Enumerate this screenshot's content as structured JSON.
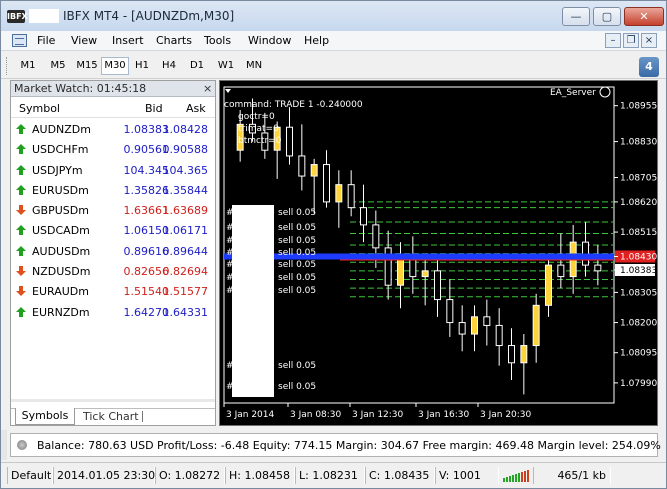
{
  "window": {
    "title": "IBFX MT4 - [AUDNZDm,M30]",
    "app_icon_text": "IBFX",
    "caption_buttons": {
      "minimize": "—",
      "maximize": "▢",
      "close": "✕"
    }
  },
  "menu": {
    "items": [
      "File",
      "View",
      "Insert",
      "Charts",
      "Tools",
      "Window",
      "Help"
    ],
    "mdi_buttons": {
      "minimize": "–",
      "restore": "❐",
      "close": "×"
    }
  },
  "timeframes": {
    "items": [
      "M1",
      "M5",
      "M15",
      "M30",
      "H1",
      "H4",
      "D1",
      "W1",
      "MN"
    ],
    "active": "M30",
    "notification_count": "4"
  },
  "market_watch": {
    "title": "Market Watch: 01:45:18",
    "close": "×",
    "columns": {
      "symbol": "Symbol",
      "bid": "Bid",
      "ask": "Ask"
    },
    "rows": [
      {
        "symbol": "AUDNZDm",
        "bid": "1.08383",
        "ask": "1.08428",
        "dir": "up"
      },
      {
        "symbol": "USDCHFm",
        "bid": "0.90561",
        "ask": "0.90588",
        "dir": "up"
      },
      {
        "symbol": "USDJPYm",
        "bid": "104.345",
        "ask": "104.365",
        "dir": "up"
      },
      {
        "symbol": "EURUSDm",
        "bid": "1.35826",
        "ask": "1.35844",
        "dir": "up"
      },
      {
        "symbol": "GBPUSDm",
        "bid": "1.63661",
        "ask": "1.63689",
        "dir": "down"
      },
      {
        "symbol": "USDCADm",
        "bid": "1.06150",
        "ask": "1.06171",
        "dir": "up"
      },
      {
        "symbol": "AUDUSDm",
        "bid": "0.89616",
        "ask": "0.89644",
        "dir": "up"
      },
      {
        "symbol": "NZDUSDm",
        "bid": "0.82656",
        "ask": "0.82694",
        "dir": "down"
      },
      {
        "symbol": "EURAUDm",
        "bid": "1.51540",
        "ask": "1.51577",
        "dir": "down"
      },
      {
        "symbol": "EURNZDm",
        "bid": "1.64270",
        "ask": "1.64331",
        "dir": "up"
      }
    ],
    "tabs": [
      "Symbols",
      "Tick Chart"
    ]
  },
  "chart": {
    "ea_name": "EA_Server",
    "ea_icon": "smiley-icon",
    "comment_lines": [
      "command: TRADE 1 -0.240000",
      "goctr=0",
      "trimat=0",
      "btmctr=0"
    ],
    "order_labels": [
      "sell 0.05",
      "sell 0.05",
      "sell 0.05",
      "sell 0.05",
      "sell 0.05",
      "sell 0.05",
      "sell 0.05",
      "sell 0.05",
      "sell 0.05"
    ],
    "price_ticks": [
      "1.08955",
      "1.08830",
      "1.08705",
      "1.08620",
      "1.08515",
      "1.08430",
      "1.08383",
      "1.08305",
      "1.08200",
      "1.08095",
      "1.07990"
    ],
    "time_ticks": [
      "3 Jan 2014",
      "3 Jan 08:30",
      "3 Jan 12:30",
      "3 Jan 16:30",
      "3 Jan 20:30"
    ],
    "colors": {
      "background": "#000000",
      "bull": "#ffd43a",
      "bear": "#000000",
      "wick": "#ffffff",
      "order_line": "#3cc83c",
      "ask_line": "#1e3cff",
      "bid_line": "#ff2020"
    }
  },
  "chart_data": {
    "type": "candlestick",
    "symbol": "AUDNZDm",
    "timeframe": "M30",
    "ylim": [
      1.0792,
      1.0902
    ],
    "yticks": [
      1.08955,
      1.0883,
      1.08705,
      1.0862,
      1.08515,
      1.0843,
      1.08383,
      1.08305,
      1.082,
      1.08095,
      1.0799
    ],
    "bid": 1.08383,
    "ask": 1.0843,
    "candles": [
      [
        1.088,
        1.0894,
        1.0876,
        1.0889
      ],
      [
        1.0889,
        1.0898,
        1.0883,
        1.0886
      ],
      [
        1.0886,
        1.0893,
        1.0877,
        1.088
      ],
      [
        1.088,
        1.089,
        1.087,
        1.0888
      ],
      [
        1.0888,
        1.0895,
        1.0875,
        1.0878
      ],
      [
        1.0878,
        1.0889,
        1.0866,
        1.0871
      ],
      [
        1.0871,
        1.0877,
        1.0858,
        1.0875
      ],
      [
        1.0875,
        1.088,
        1.086,
        1.0862
      ],
      [
        1.0862,
        1.0873,
        1.0853,
        1.0868
      ],
      [
        1.0868,
        1.0873,
        1.0857,
        1.086
      ],
      [
        1.086,
        1.0868,
        1.0848,
        1.0854
      ],
      [
        1.0854,
        1.0859,
        1.0839,
        1.0846
      ],
      [
        1.0846,
        1.0852,
        1.0828,
        1.0833
      ],
      [
        1.0833,
        1.0848,
        1.0825,
        1.0843
      ],
      [
        1.0843,
        1.085,
        1.083,
        1.0836
      ],
      [
        1.0836,
        1.0842,
        1.0826,
        1.0838
      ],
      [
        1.0838,
        1.0842,
        1.0822,
        1.0828
      ],
      [
        1.0828,
        1.0835,
        1.0815,
        1.082
      ],
      [
        1.082,
        1.0826,
        1.081,
        1.0816
      ],
      [
        1.0816,
        1.0826,
        1.081,
        1.0822
      ],
      [
        1.0822,
        1.0828,
        1.0812,
        1.0819
      ],
      [
        1.0819,
        1.0825,
        1.0805,
        1.0812
      ],
      [
        1.0812,
        1.0818,
        1.08,
        1.0806
      ],
      [
        1.0806,
        1.0816,
        1.0795,
        1.0812
      ],
      [
        1.0812,
        1.083,
        1.0806,
        1.0826
      ],
      [
        1.0826,
        1.0844,
        1.0822,
        1.084
      ],
      [
        1.084,
        1.0851,
        1.0832,
        1.0836
      ],
      [
        1.0836,
        1.0854,
        1.083,
        1.0848
      ],
      [
        1.0848,
        1.0855,
        1.0836,
        1.084
      ],
      [
        1.084,
        1.0847,
        1.0833,
        1.0838
      ]
    ],
    "order_levels": [
      1.0862,
      1.086,
      1.0855,
      1.0851,
      1.0847,
      1.0844,
      1.0841,
      1.0838,
      1.0835,
      1.0832,
      1.0829
    ]
  },
  "terminal": {
    "text": "Balance: 780.63 USD  Profit/Loss: -6.48  Equity: 774.15  Margin: 304.67  Free margin: 469.48  Margin level: 254.09%"
  },
  "status": {
    "profile": "Default",
    "datetime": "2014.01.05 23:30",
    "open": "O: 1.08272",
    "high": "H: 1.08458",
    "low": "L: 1.08231",
    "close": "C: 1.08435",
    "volume": "V: 1001",
    "traffic": "465/1 kb"
  }
}
